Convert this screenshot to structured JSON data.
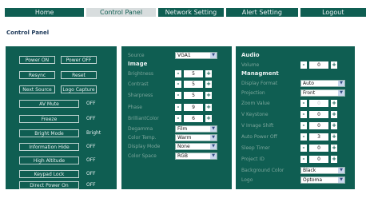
{
  "nav": {
    "tabs": [
      {
        "label": "Home",
        "active": false
      },
      {
        "label": "Control Panel",
        "active": true
      },
      {
        "label": "Network Setting",
        "active": false
      },
      {
        "label": "Alert Setting",
        "active": false
      },
      {
        "label": "Logout",
        "active": false
      }
    ]
  },
  "page_title": "Control Panel",
  "left": {
    "power_on": "Power ON",
    "power_off": "Power OFF",
    "resync": "Resync",
    "reset": "Reset",
    "next_source": "Next Source",
    "logo_capture": "Logo Capture",
    "toggles": [
      {
        "label": "AV Mute",
        "value": "OFF"
      },
      {
        "label": "Freeze",
        "value": "OFF"
      },
      {
        "label": "Bright Mode",
        "value": "Bright"
      },
      {
        "label": "Information Hide",
        "value": "OFF"
      },
      {
        "label": "High Altitude",
        "value": "OFF"
      },
      {
        "label": "Keypad Lock",
        "value": "OFF"
      },
      {
        "label": "Direct Power On",
        "value": "OFF"
      }
    ]
  },
  "middle": {
    "source_label": "Source",
    "source_value": "VGA1",
    "image_header": "Image",
    "brightness": {
      "label": "Brightness",
      "value": "5"
    },
    "contrast": {
      "label": "Contrast",
      "value": "5"
    },
    "sharpness": {
      "label": "Sharpness",
      "value": "5"
    },
    "phase": {
      "label": "Phase",
      "value": "9"
    },
    "brilliant_color": {
      "label": "BrilliantColor",
      "value": "6"
    },
    "degamma": {
      "label": "Degamma",
      "value": "Film"
    },
    "color_temp": {
      "label": "Color Temp.",
      "value": "Warm"
    },
    "display_mode": {
      "label": "Display Mode",
      "value": "None"
    },
    "color_space": {
      "label": "Color Space",
      "value": "RGB"
    }
  },
  "right": {
    "audio_header": "Audio",
    "volume": {
      "label": "Volume",
      "value": "0"
    },
    "management_header": "Managment",
    "display_format": {
      "label": "Display Format",
      "value": "Auto"
    },
    "projection": {
      "label": "Projection",
      "value": "Front"
    },
    "zoom_value": {
      "label": "Zoom Value",
      "value": "0"
    },
    "v_keystone": {
      "label": "V Keystone",
      "value": "0"
    },
    "v_image_shift": {
      "label": "V Image Shift",
      "value": "0"
    },
    "auto_power_off": {
      "label": "Auto Power Off",
      "value": "3"
    },
    "sleep_timer": {
      "label": "Sleep Timer",
      "value": "0"
    },
    "projector_id": {
      "label": "Project ID",
      "value": "0"
    },
    "background_color": {
      "label": "Background Color",
      "value": "Black"
    },
    "logo": {
      "label": "Logo",
      "value": "Optoma"
    }
  },
  "colors": {
    "accent": "#0f5e52",
    "label": "#7ca69c",
    "active_tab": "#d8ddde"
  }
}
